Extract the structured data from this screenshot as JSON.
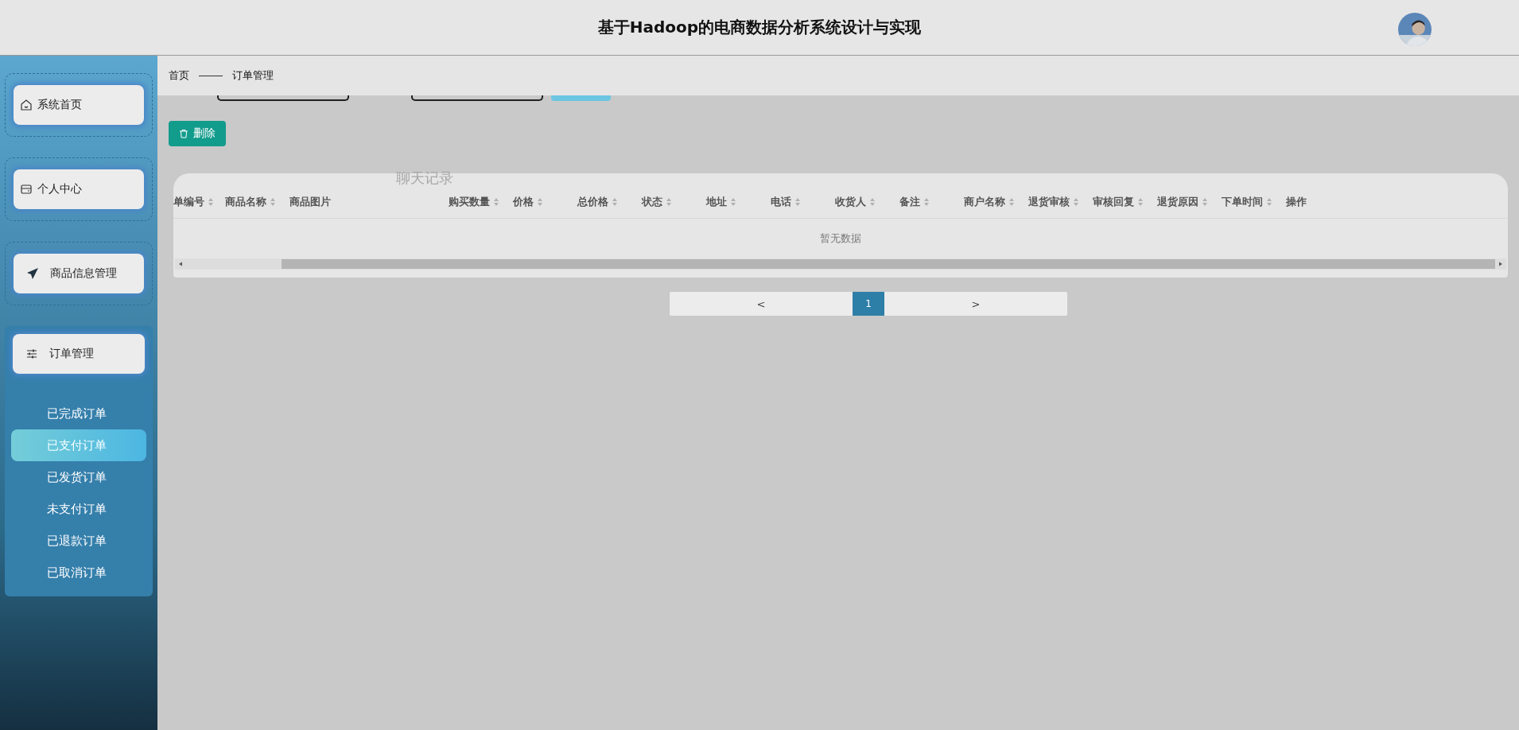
{
  "header": {
    "title": "基于Hadoop的电商数据分析系统设计与实现"
  },
  "sidebar": {
    "items": [
      {
        "label": "系统首页",
        "kind": "home",
        "expanded": false
      },
      {
        "label": "个人中心",
        "kind": "card",
        "expanded": false
      },
      {
        "label": "商品信息管理",
        "kind": "send",
        "expanded": false
      },
      {
        "label": "订单管理",
        "kind": "sliders",
        "expanded": true,
        "children": [
          {
            "label": "已完成订单",
            "selected": false
          },
          {
            "label": "已支付订单",
            "selected": true
          },
          {
            "label": "已发货订单",
            "selected": false
          },
          {
            "label": "未支付订单",
            "selected": false
          },
          {
            "label": "已退款订单",
            "selected": false
          },
          {
            "label": "已取消订单",
            "selected": false
          }
        ]
      }
    ]
  },
  "breadcrumb": [
    {
      "label": "首页"
    },
    {
      "label": "订单管理"
    }
  ],
  "dialog_title": "聊天记录",
  "delete_button": "删除",
  "table": {
    "columns": [
      {
        "label": "单编号",
        "sortable": true,
        "wide": false
      },
      {
        "label": "商品名称",
        "sortable": true,
        "wide": false
      },
      {
        "label": "商品图片",
        "sortable": false,
        "wide": true
      },
      {
        "label": "购买数量",
        "sortable": true,
        "wide": false
      },
      {
        "label": "价格",
        "sortable": true,
        "wide": false
      },
      {
        "label": "总价格",
        "sortable": true,
        "wide": false
      },
      {
        "label": "状态",
        "sortable": true,
        "wide": false
      },
      {
        "label": "地址",
        "sortable": true,
        "wide": false
      },
      {
        "label": "电话",
        "sortable": true,
        "wide": false
      },
      {
        "label": "收货人",
        "sortable": true,
        "wide": false
      },
      {
        "label": "备注",
        "sortable": true,
        "wide": false
      },
      {
        "label": "商户名称",
        "sortable": true,
        "wide": false
      },
      {
        "label": "退货审核",
        "sortable": true,
        "wide": false
      },
      {
        "label": "审核回复",
        "sortable": true,
        "wide": false
      },
      {
        "label": "退货原因",
        "sortable": true,
        "wide": false
      },
      {
        "label": "下单时间",
        "sortable": true,
        "wide": false
      },
      {
        "label": "操作",
        "sortable": false,
        "wide": false
      }
    ],
    "empty_text": "暂无数据"
  },
  "pagination": {
    "prev": "<",
    "next": ">",
    "pages": [
      {
        "label": "1",
        "selected": true
      }
    ]
  }
}
